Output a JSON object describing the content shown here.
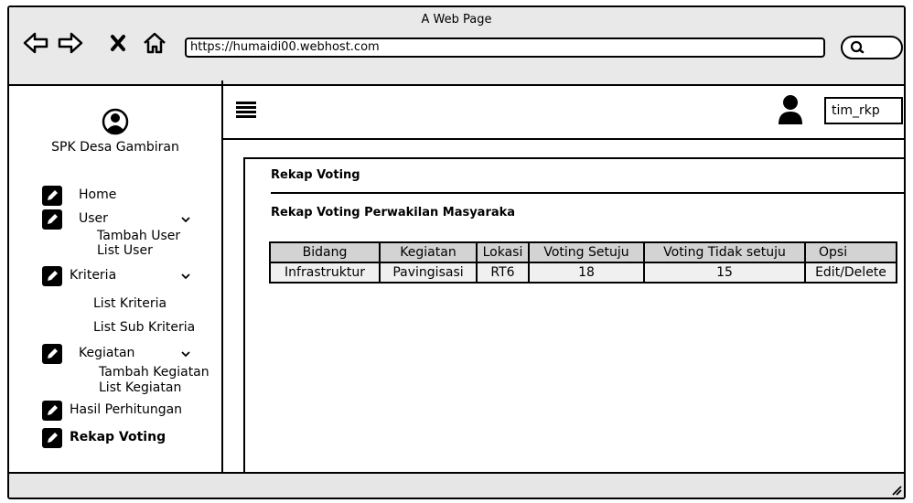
{
  "window": {
    "title": "A Web Page"
  },
  "browser": {
    "url": "https://humaidi00.webhost.com"
  },
  "sidebar": {
    "brand": "SPK Desa Gambiran",
    "items": [
      {
        "label": "Home"
      },
      {
        "label": "User",
        "subitems": [
          "Tambah User",
          "List User"
        ]
      },
      {
        "label": "Kriteria",
        "subitems": [
          "List Kriteria",
          "List Sub Kriteria"
        ]
      },
      {
        "label": "Kegiatan",
        "subitems": [
          "Tambah Kegiatan",
          "List Kegiatan"
        ]
      },
      {
        "label": "Hasil Perhitungan"
      },
      {
        "label": "Rekap Voting",
        "active": true
      }
    ]
  },
  "header": {
    "username": "tim_rkp"
  },
  "main": {
    "title": "Rekap Voting",
    "subtitle": "Rekap Voting Perwakilan Masyaraka",
    "table": {
      "columns": [
        "Bidang",
        "Kegiatan",
        "Lokasi",
        "Voting Setuju",
        "Voting Tidak setuju",
        "Opsi"
      ],
      "rows": [
        [
          "Infrastruktur",
          "Pavingisasi",
          "RT6",
          "18",
          "15",
          "Edit/Delete"
        ]
      ]
    }
  },
  "icons": {
    "back": "arrow-left-icon",
    "forward": "arrow-right-icon",
    "stop": "close-icon",
    "home": "home-icon",
    "search": "search-icon",
    "menu": "hamburger-icon",
    "user": "user-icon",
    "edit": "pencil-icon"
  }
}
